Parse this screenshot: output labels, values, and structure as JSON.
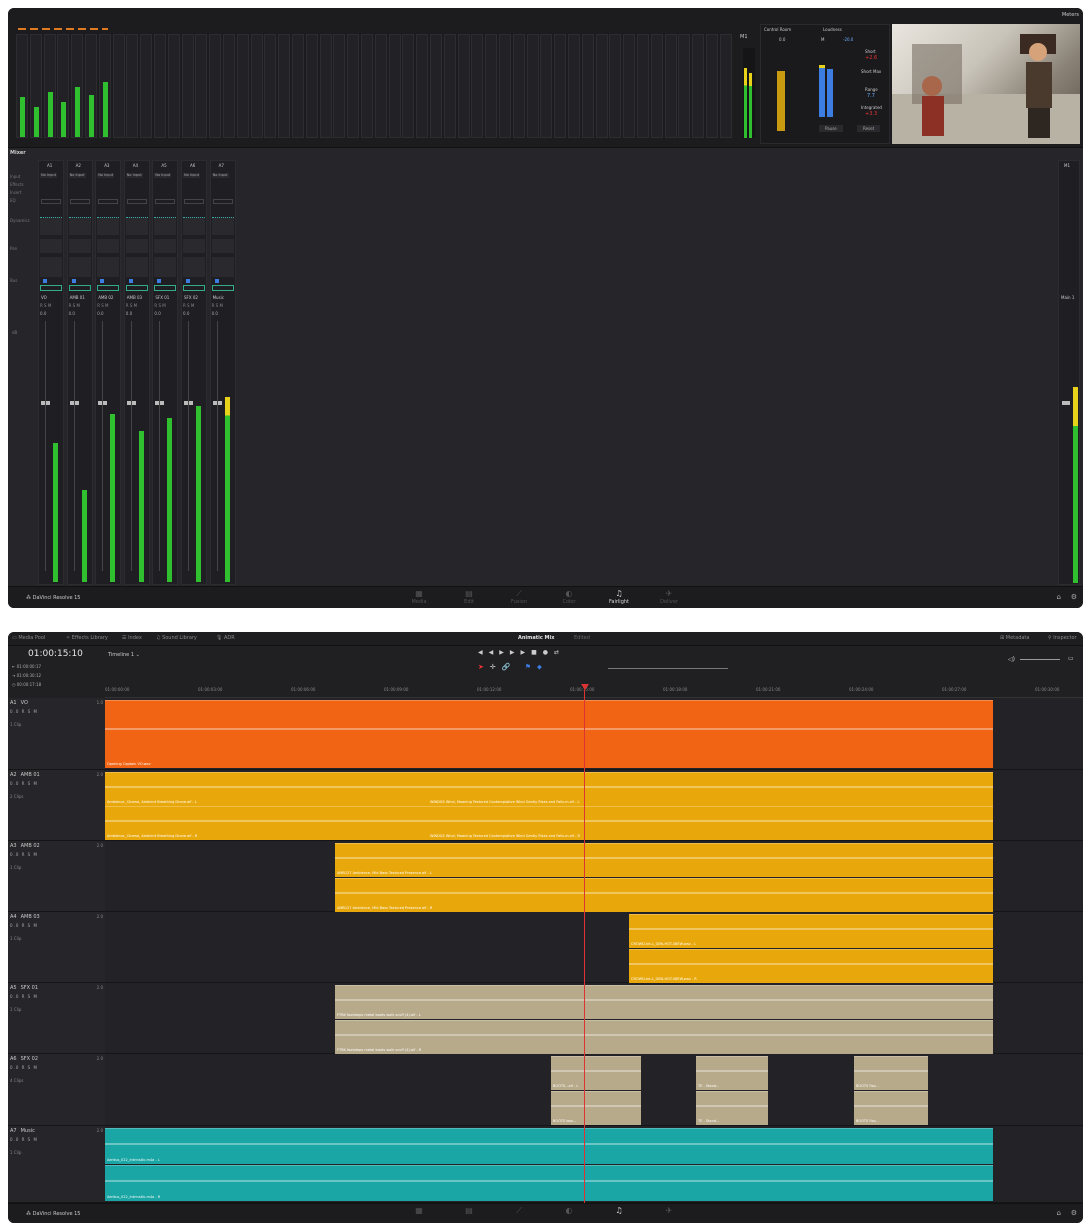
{
  "window1": {
    "meters_label": "Meters",
    "monitor": {
      "control_room": "Control Room",
      "loudness": "Loudness",
      "short_label": "Short",
      "short_value": "+2.6",
      "short_max_label": "Short Max",
      "range_label": "Range",
      "range_value": "7.7",
      "integrated_label": "Integrated",
      "integrated_value": "+3.3",
      "pause": "Pause",
      "reset": "Reset",
      "m1": "M1",
      "cr_value": "0.0",
      "m_label": "M",
      "m_value": "-20.0"
    },
    "mixer_title": "Mixer",
    "row_labels": [
      "Input",
      "Effects",
      "Insert",
      "EQ",
      "Dynamics",
      "Pan",
      "Bus"
    ],
    "channels": [
      "A1",
      "A2",
      "A3",
      "A4",
      "A5",
      "A6",
      "A7"
    ],
    "inputs": [
      "No Input",
      "No Input",
      "No Input",
      "No Input",
      "No Input",
      "No Input",
      "No Input"
    ],
    "track_names": [
      "VO",
      "AMB 01",
      "AMB 02",
      "AMB 03",
      "SFX 01",
      "SFX 02",
      "Music"
    ],
    "fader_value": "0.0",
    "db_label": "dB",
    "main_channel": "M1",
    "main_name": "Main 1",
    "levels": [
      0.33,
      0.22,
      0.4,
      0.36,
      0.39,
      0.42,
      0.44
    ],
    "app_name": "DaVinci Resolve 15"
  },
  "page_tabs": [
    {
      "label": "Media",
      "icon": "media-icon"
    },
    {
      "label": "Edit",
      "icon": "edit-icon"
    },
    {
      "label": "Fusion",
      "icon": "fusion-icon"
    },
    {
      "label": "Color",
      "icon": "color-icon"
    },
    {
      "label": "Fairlight",
      "icon": "fairlight-icon"
    },
    {
      "label": "Deliver",
      "icon": "deliver-icon"
    }
  ],
  "window2": {
    "toolbar": {
      "media_pool": "Media Pool",
      "effects_library": "Effects Library",
      "index": "Index",
      "sound_library": "Sound Library",
      "adr": "ADR",
      "title": "Animatic Mix",
      "status": "Edited",
      "metadata": "Metadata",
      "inspector": "Inspector"
    },
    "timecode": "01:00:15:10",
    "timeline_name": "Timeline 1",
    "in_tc": "01:00:00:17",
    "out_tc": "01:00:30:12",
    "dur_tc": "00:00:17:18",
    "ruler": [
      "01:00:00:00",
      "01:00:03:00",
      "01:00:06:00",
      "01:00:09:00",
      "01:00:12:00",
      "01:00:15:00",
      "01:00:18:00",
      "01:00:21:00",
      "01:00:24:00",
      "01:00:27:00",
      "01:00:30:00"
    ],
    "tracks": [
      {
        "id": "A1",
        "name": "VO",
        "num": "1.0",
        "clips_label": "1 Clip"
      },
      {
        "id": "A2",
        "name": "AMB 01",
        "num": "2.0",
        "clips_label": "2 Clips"
      },
      {
        "id": "A3",
        "name": "AMB 02",
        "num": "2.0",
        "clips_label": "1 Clip"
      },
      {
        "id": "A4",
        "name": "AMB 03",
        "num": "2.0",
        "clips_label": "1 Clip"
      },
      {
        "id": "A5",
        "name": "SFX 01",
        "num": "2.0",
        "clips_label": "1 Clip"
      },
      {
        "id": "A6",
        "name": "SFX 02",
        "num": "2.0",
        "clips_label": "4 Clips"
      },
      {
        "id": "A7",
        "name": "Music",
        "num": "2.0",
        "clips_label": "1 Clip"
      }
    ],
    "track_ctrl": "0.0  R S M",
    "clip_names": {
      "vo": "Opening Captain VO.wav",
      "amb01_l": "Ambience_ Drama, Ambient Breathing Drone.aif - L",
      "amb01_r": "Ambience_ Drama, Ambient Breathing Drone.aif - R",
      "amb01b_l": "WINDGS Wind, Moaning Textured Contemplative Wind Gently Rises and Falls.m.aif - L",
      "amb01b_r": "WINDGS Wind, Moaning Textured Contemplative Wind Gently Rises and Falls.m.aif - R",
      "amb02_l": "AMB127 Ambience, Mid Bass Textured Presence.aif - L",
      "amb02_r": "AMB127 Ambience, Mid Bass Textured Presence.aif - R",
      "amb03_l": "CROWD-Int-L_GEN-HOT-08EW.wav - L",
      "amb03_r": "CROWD-Int-L_GEN-HOT-08EW.wav - R",
      "sfx01_l": "FTRK footsteps metal boots walk scuff (4).aif - L",
      "sfx01_r": "FTRK footsteps metal boots walk scuff (4).aif - R",
      "sfx02_a": "BOOTS...aif - L",
      "sfx02_b": "BOOTS boo...",
      "sfx02_c": "TE - Stand...",
      "sfx02_d": "BOOTS Foo...",
      "music_l": "Aeritus_022_Intrinsilic.m4a - L",
      "music_r": "Aeritus_022_Intrinsilic.m4a - R"
    },
    "app_name": "DaVinci Resolve 15"
  },
  "colors": {
    "orange": "#f06414",
    "amber": "#e8a80c",
    "tan": "#b7aa8a",
    "teal": "#1aa6a4",
    "meter_green": "#2fbf2f",
    "playhead": "#d33"
  }
}
